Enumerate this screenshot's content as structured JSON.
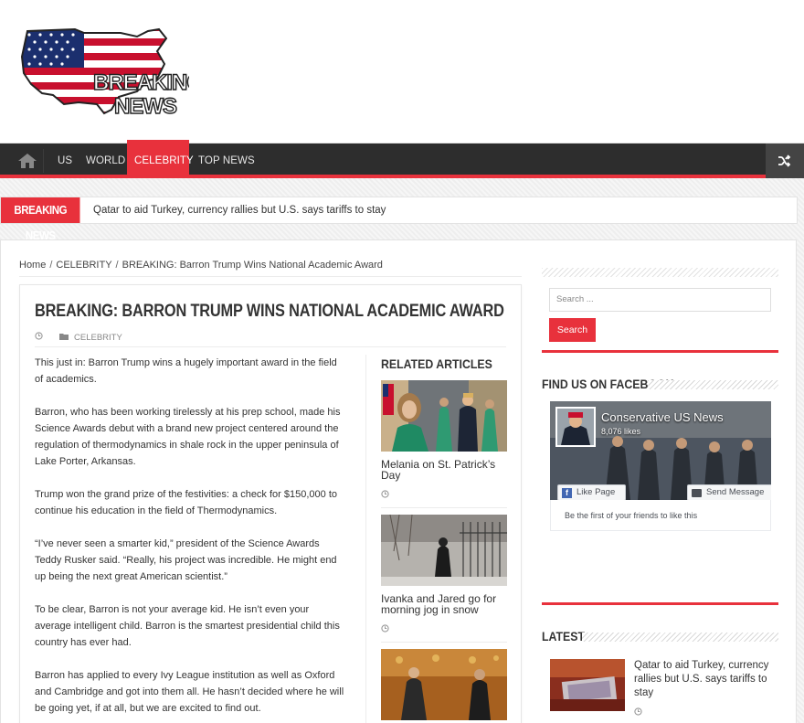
{
  "logo": {
    "line1": "BREAKING",
    "line2": "NEWS"
  },
  "nav": {
    "items": [
      {
        "label": "US"
      },
      {
        "label": "WORLD"
      },
      {
        "label": "CELEBRITY"
      },
      {
        "label": "TOP NEWS"
      }
    ],
    "active": "CELEBRITY",
    "accent_color": "#e8313c"
  },
  "ticker": {
    "label": "BREAKING NEWS",
    "headline": "Qatar to aid Turkey, currency rallies but U.S. says tariffs to stay"
  },
  "breadcrumb": {
    "home": "Home",
    "category": "CELEBRITY",
    "current": "BREAKING: Barron Trump Wins National Academic Award"
  },
  "article": {
    "title": "BREAKING: BARRON TRUMP WINS NATIONAL ACADEMIC AWARD",
    "category": "CELEBRITY",
    "paragraphs": [
      "This just in: Barron Trump wins a hugely important award in the field of academics.",
      "Barron, who has been working tirelessly at his prep school, made his Science Awards debut with a brand new project centered around the regulation of thermodynamics in shale rock in the upper peninsula of Lake Porter, Arkansas.",
      "Trump won the grand prize of the festivities: a check for $150,000 to continue his education in the field of Thermodynamics.",
      "“I’ve never seen a smarter kid,” president of the Science Awards Teddy Rusker said. “Really, his project was incredible. He might end up being the next great American scientist.”",
      "To be clear, Barron is not your average kid. He isn’t even your average intelligent child. Barron is the smartest presidential child this country has ever had.",
      "Barron has applied to every Ivy League institution as well as Oxford and Cambridge and got into them all. He hasn’t decided where he will be going yet, if at all, but we are excited to find out."
    ]
  },
  "related": {
    "heading": "RELATED ARTICLES",
    "items": [
      {
        "title": "Melania on St. Patrick’s Day"
      },
      {
        "title": "Ivanka and Jared go for morning jog in snow"
      },
      {
        "title": ""
      }
    ]
  },
  "sidebar": {
    "search": {
      "placeholder": "Search ...",
      "button": "Search"
    },
    "facebook": {
      "heading": "FIND US ON FACEBOOK",
      "page_name": "Conservative US News",
      "likes": "8,076 likes",
      "like_button": "Like Page",
      "message_button": "Send Message",
      "friends_text": "Be the first of your friends to like this"
    },
    "latest": {
      "heading": "LATEST",
      "items": [
        {
          "title": "Qatar to aid Turkey, currency rallies but U.S. says tariffs to stay"
        }
      ]
    }
  }
}
